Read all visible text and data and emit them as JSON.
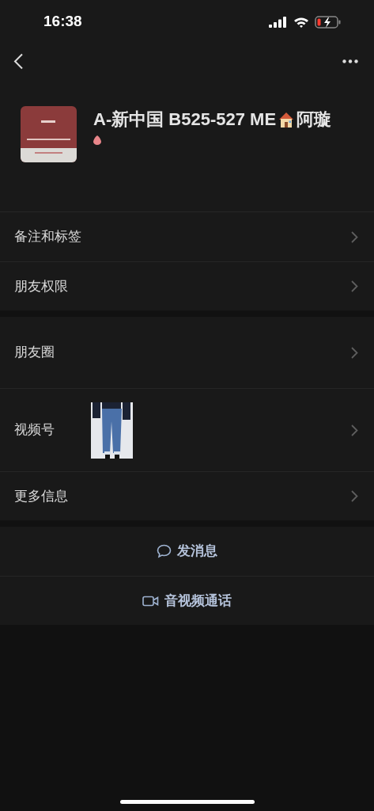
{
  "status_bar": {
    "time": "16:38"
  },
  "profile": {
    "name": "A-新中国 B525-527 ME",
    "name_suffix": "阿璇"
  },
  "groups": [
    {
      "rows": [
        {
          "label": "备注和标签",
          "kind": "plain"
        },
        {
          "label": "朋友权限",
          "kind": "plain"
        }
      ]
    },
    {
      "rows": [
        {
          "label": "朋友圈",
          "kind": "tall"
        },
        {
          "label": "视频号",
          "kind": "thumbnail"
        },
        {
          "label": "更多信息",
          "kind": "plain"
        }
      ]
    }
  ],
  "actions": [
    {
      "label": "发消息",
      "kind": "message"
    },
    {
      "label": "音视频通话",
      "kind": "call"
    }
  ]
}
